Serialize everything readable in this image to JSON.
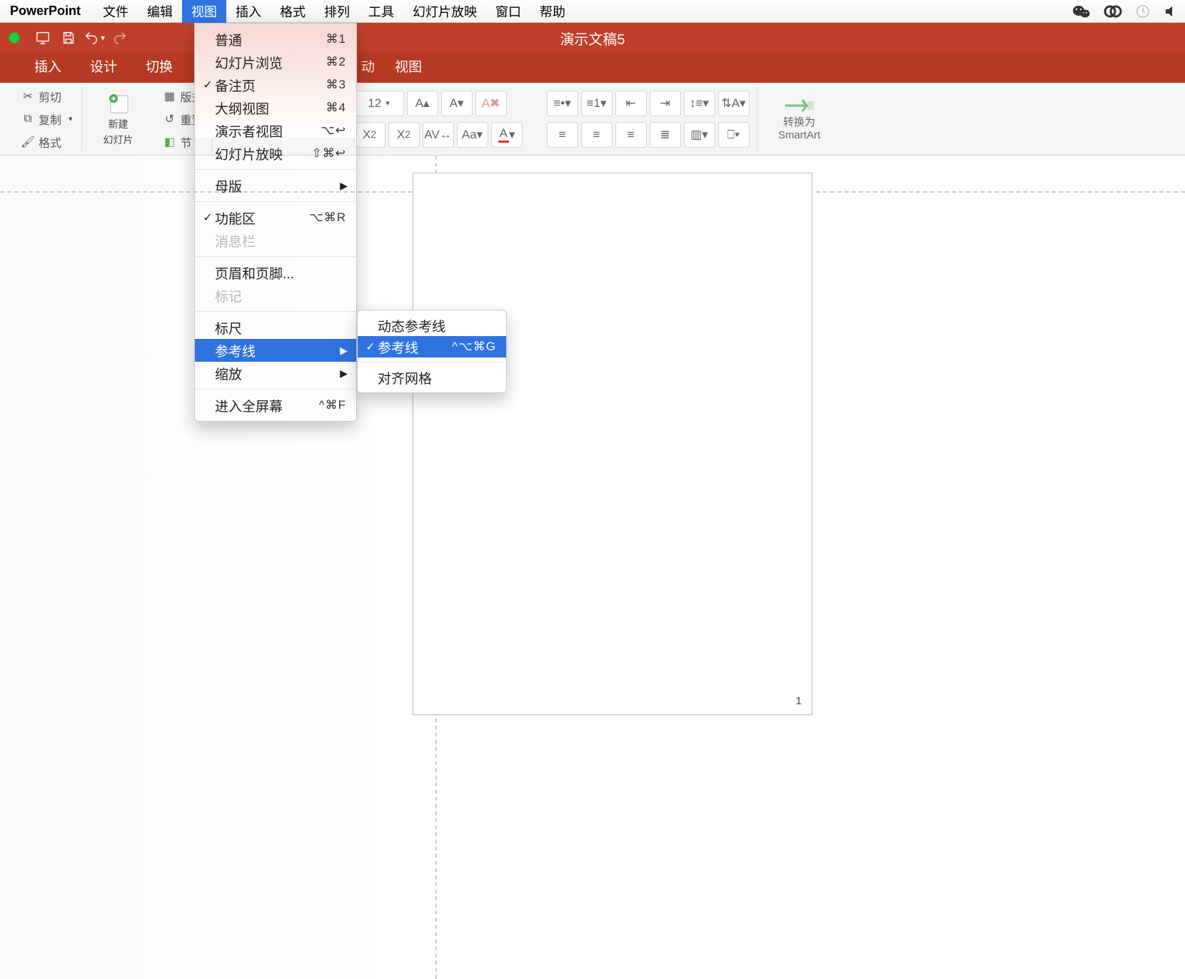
{
  "menubar": {
    "app": "PowerPoint",
    "items": [
      "文件",
      "编辑",
      "视图",
      "插入",
      "格式",
      "排列",
      "工具",
      "幻灯片放映",
      "窗口",
      "帮助"
    ],
    "activeIndex": 2
  },
  "titlebar": {
    "document": "演示文稿5"
  },
  "ribbon_tabs": {
    "left": [
      "插入",
      "设计",
      "切换"
    ],
    "right": [
      "视图"
    ],
    "hidden_behind": "动"
  },
  "clipboard": {
    "cut": "剪切",
    "copy": "复制",
    "format": "格式"
  },
  "newslide": {
    "label_line1": "新建",
    "label_line2": "幻灯片",
    "layout": "版式",
    "reset": "重置",
    "section": "节"
  },
  "fontsize": "12",
  "convert": {
    "line1": "转换为",
    "line2": "SmartArt"
  },
  "view_menu": {
    "items": [
      {
        "label": "普通",
        "shortcut": "⌘1"
      },
      {
        "label": "幻灯片浏览",
        "shortcut": "⌘2"
      },
      {
        "label": "备注页",
        "shortcut": "⌘3",
        "checked": true
      },
      {
        "label": "大纲视图",
        "shortcut": "⌘4"
      },
      {
        "label": "演示者视图",
        "shortcut": "⌥↩"
      },
      {
        "label": "幻灯片放映",
        "shortcut": "⇧⌘↩"
      }
    ],
    "master": "母版",
    "ribbon": {
      "label": "功能区",
      "shortcut": "⌥⌘R",
      "checked": true
    },
    "msgbar": "消息栏",
    "headerfooter": "页眉和页脚...",
    "mark": "标记",
    "ruler": "标尺",
    "guides": "参考线",
    "zoom": "缩放",
    "fullscreen": {
      "label": "进入全屏幕",
      "shortcut": "^⌘F"
    }
  },
  "submenu": {
    "dynamic": "动态参考线",
    "guides": {
      "label": "参考线",
      "shortcut": "^⌥⌘G",
      "checked": true
    },
    "snap": "对齐网格"
  },
  "page_number": "1"
}
